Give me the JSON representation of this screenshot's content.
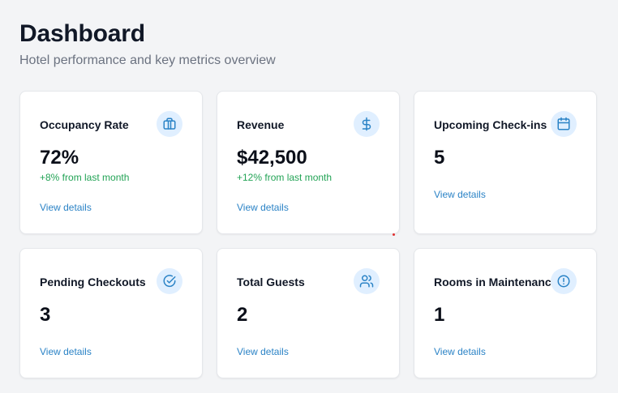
{
  "header": {
    "title": "Dashboard",
    "subtitle": "Hotel performance and key metrics overview"
  },
  "cards": [
    {
      "label": "Occupancy Rate",
      "value": "72%",
      "change": "+8% from last month",
      "link": "View details",
      "icon": "briefcase-icon"
    },
    {
      "label": "Revenue",
      "value": "$42,500",
      "change": "+12% from last month",
      "link": "View details",
      "icon": "dollar-icon"
    },
    {
      "label": "Upcoming Check-ins",
      "value": "5",
      "change": "",
      "link": "View details",
      "icon": "calendar-icon"
    },
    {
      "label": "Pending Checkouts",
      "value": "3",
      "change": "",
      "link": "View details",
      "icon": "check-circle-icon"
    },
    {
      "label": "Total Guests",
      "value": "2",
      "change": "",
      "link": "View details",
      "icon": "users-icon"
    },
    {
      "label": "Rooms in Maintenance",
      "value": "1",
      "change": "",
      "link": "View details",
      "icon": "alert-circle-icon"
    }
  ],
  "colors": {
    "background": "#f3f4f6",
    "accent": "#2b83c6",
    "icon_bg": "#e0efff",
    "positive": "#22a355"
  }
}
